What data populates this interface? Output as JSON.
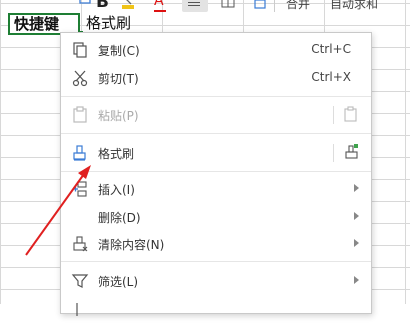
{
  "toolbar": {
    "bold_label": "B",
    "font_color_label": "A",
    "merge_label": "合并",
    "autosum_label": "自动求和"
  },
  "cells": {
    "a1": "快捷键",
    "b1": "格式刷"
  },
  "menu": {
    "items": [
      {
        "label": "复制(C)",
        "shortcut": "Ctrl+C",
        "icon": "copy-icon"
      },
      {
        "label": "剪切(T)",
        "shortcut": "Ctrl+X",
        "icon": "cut-icon"
      },
      {
        "label": "粘贴(P)",
        "icon": "paste-icon",
        "disabled": true
      },
      {
        "label": "格式刷",
        "icon": "format-painter-icon"
      },
      {
        "label": "插入(I)",
        "icon": "insert-icon",
        "submenu": true
      },
      {
        "label": "删除(D)",
        "icon": "",
        "submenu": true
      },
      {
        "label": "清除内容(N)",
        "icon": "clear-icon",
        "submenu": true
      },
      {
        "label": "筛选(L)",
        "icon": "filter-icon",
        "submenu": true
      }
    ]
  },
  "colors": {
    "accent_green": "#1e7e34",
    "annotation_red": "#e02020",
    "icon_blue": "#3a7bd5"
  }
}
